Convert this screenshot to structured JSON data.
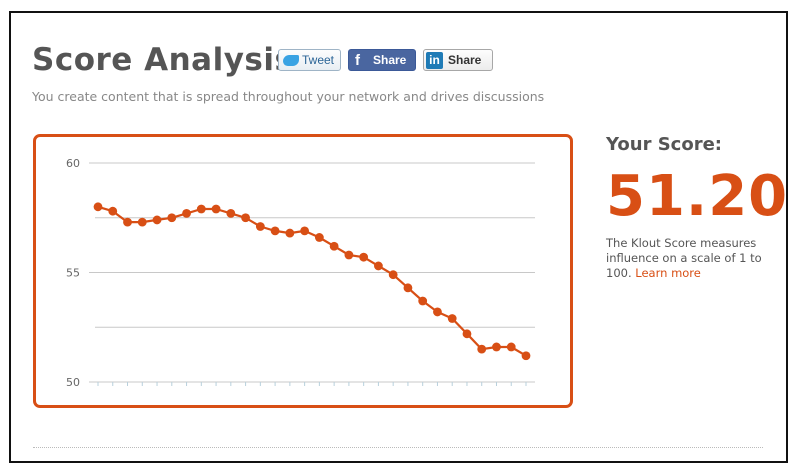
{
  "header": {
    "title": "Score Analysis",
    "subtitle": "You create content that is spread throughout your network and drives discussions"
  },
  "share_buttons": {
    "tweet_label": "Tweet",
    "facebook_label": "Share",
    "facebook_icon_glyph": "f",
    "linkedin_label": "Share",
    "linkedin_icon_glyph": "in"
  },
  "score": {
    "label": "Your Score:",
    "value": "51.20",
    "description": "The Klout Score measures influence on a scale of 1 to 100.",
    "learn_more": "Learn more"
  },
  "colors": {
    "accent": "#d84f15",
    "line": "#d84f15",
    "gridline": "#c8c8c8",
    "text_muted": "#888888"
  },
  "chart_data": {
    "type": "line",
    "title": "",
    "xlabel": "",
    "ylabel": "",
    "ylim": [
      50,
      60
    ],
    "yticks": [
      50,
      55,
      60
    ],
    "gridlines": [
      50,
      52.5,
      55,
      57.5,
      60
    ],
    "grid": true,
    "series": [
      {
        "values": [
          58.0,
          57.8,
          57.3,
          57.3,
          57.4,
          57.5,
          57.7,
          57.9,
          57.9,
          57.7,
          57.5,
          57.1,
          56.9,
          56.8,
          56.9,
          56.6,
          56.2,
          55.8,
          55.7,
          55.3,
          54.9,
          54.3,
          53.7,
          53.2,
          52.9,
          52.2,
          51.5,
          51.6,
          51.6,
          51.2
        ]
      }
    ]
  }
}
